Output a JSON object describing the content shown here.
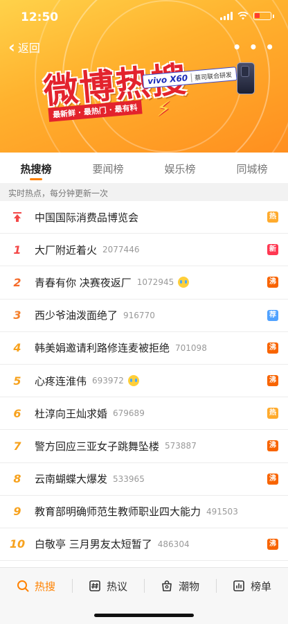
{
  "status_bar": {
    "time": "12:50"
  },
  "header": {
    "back_label": "返回",
    "more_label": "• • •",
    "logo_text": "微博热搜",
    "slogan": "最新鲜 · 最热门 · 最有料",
    "sponsor_brand": "vivo X60",
    "sponsor_note": "蔡司联合研发"
  },
  "tabs": [
    {
      "label": "热搜榜",
      "active": true
    },
    {
      "label": "要闻榜",
      "active": false
    },
    {
      "label": "娱乐榜",
      "active": false
    },
    {
      "label": "同城榜",
      "active": false
    }
  ],
  "subheader": "实时热点，每分钟更新一次",
  "list": [
    {
      "rank": "",
      "pinned": true,
      "title": "中国国际消费品博览会",
      "count": "",
      "emoji": false,
      "badge": "热",
      "badge_type": "hot"
    },
    {
      "rank": "1",
      "title": "大厂附近着火",
      "count": "2077446",
      "emoji": false,
      "badge": "新",
      "badge_type": "new"
    },
    {
      "rank": "2",
      "title": "青春有你 决赛夜返厂",
      "count": "1072945",
      "emoji": true,
      "badge": "沸",
      "badge_type": "boil"
    },
    {
      "rank": "3",
      "title": "西少爷油泼面绝了",
      "count": "916770",
      "emoji": false,
      "badge": "荐",
      "badge_type": "rec"
    },
    {
      "rank": "4",
      "title": "韩美娟邀请利路修连麦被拒绝",
      "count": "701098",
      "emoji": false,
      "badge": "沸",
      "badge_type": "boil"
    },
    {
      "rank": "5",
      "title": "心疼连淮伟",
      "count": "693972",
      "emoji": true,
      "badge": "沸",
      "badge_type": "boil"
    },
    {
      "rank": "6",
      "title": "杜淳向王灿求婚",
      "count": "679689",
      "emoji": false,
      "badge": "热",
      "badge_type": "hot"
    },
    {
      "rank": "7",
      "title": "警方回应三亚女子跳舞坠楼",
      "count": "573887",
      "emoji": false,
      "badge": "沸",
      "badge_type": "boil"
    },
    {
      "rank": "8",
      "title": "云南蝴蝶大爆发",
      "count": "533965",
      "emoji": false,
      "badge": "沸",
      "badge_type": "boil"
    },
    {
      "rank": "9",
      "title": "教育部明确师范生教师职业四大能力",
      "count": "491503",
      "emoji": false,
      "badge": "",
      "badge_type": ""
    },
    {
      "rank": "10",
      "title": "白敬亭 三月男友太短暂了",
      "count": "486304",
      "emoji": false,
      "badge": "沸",
      "badge_type": "boil"
    }
  ],
  "bottom_nav": [
    {
      "label": "热搜",
      "icon": "search-icon",
      "active": true
    },
    {
      "label": "热议",
      "icon": "topic-icon",
      "active": false
    },
    {
      "label": "潮物",
      "icon": "bag-icon",
      "active": false
    },
    {
      "label": "榜单",
      "icon": "chart-icon",
      "active": false
    }
  ],
  "colors": {
    "accent": "#ff8200",
    "brand_red": "#e3232d"
  }
}
